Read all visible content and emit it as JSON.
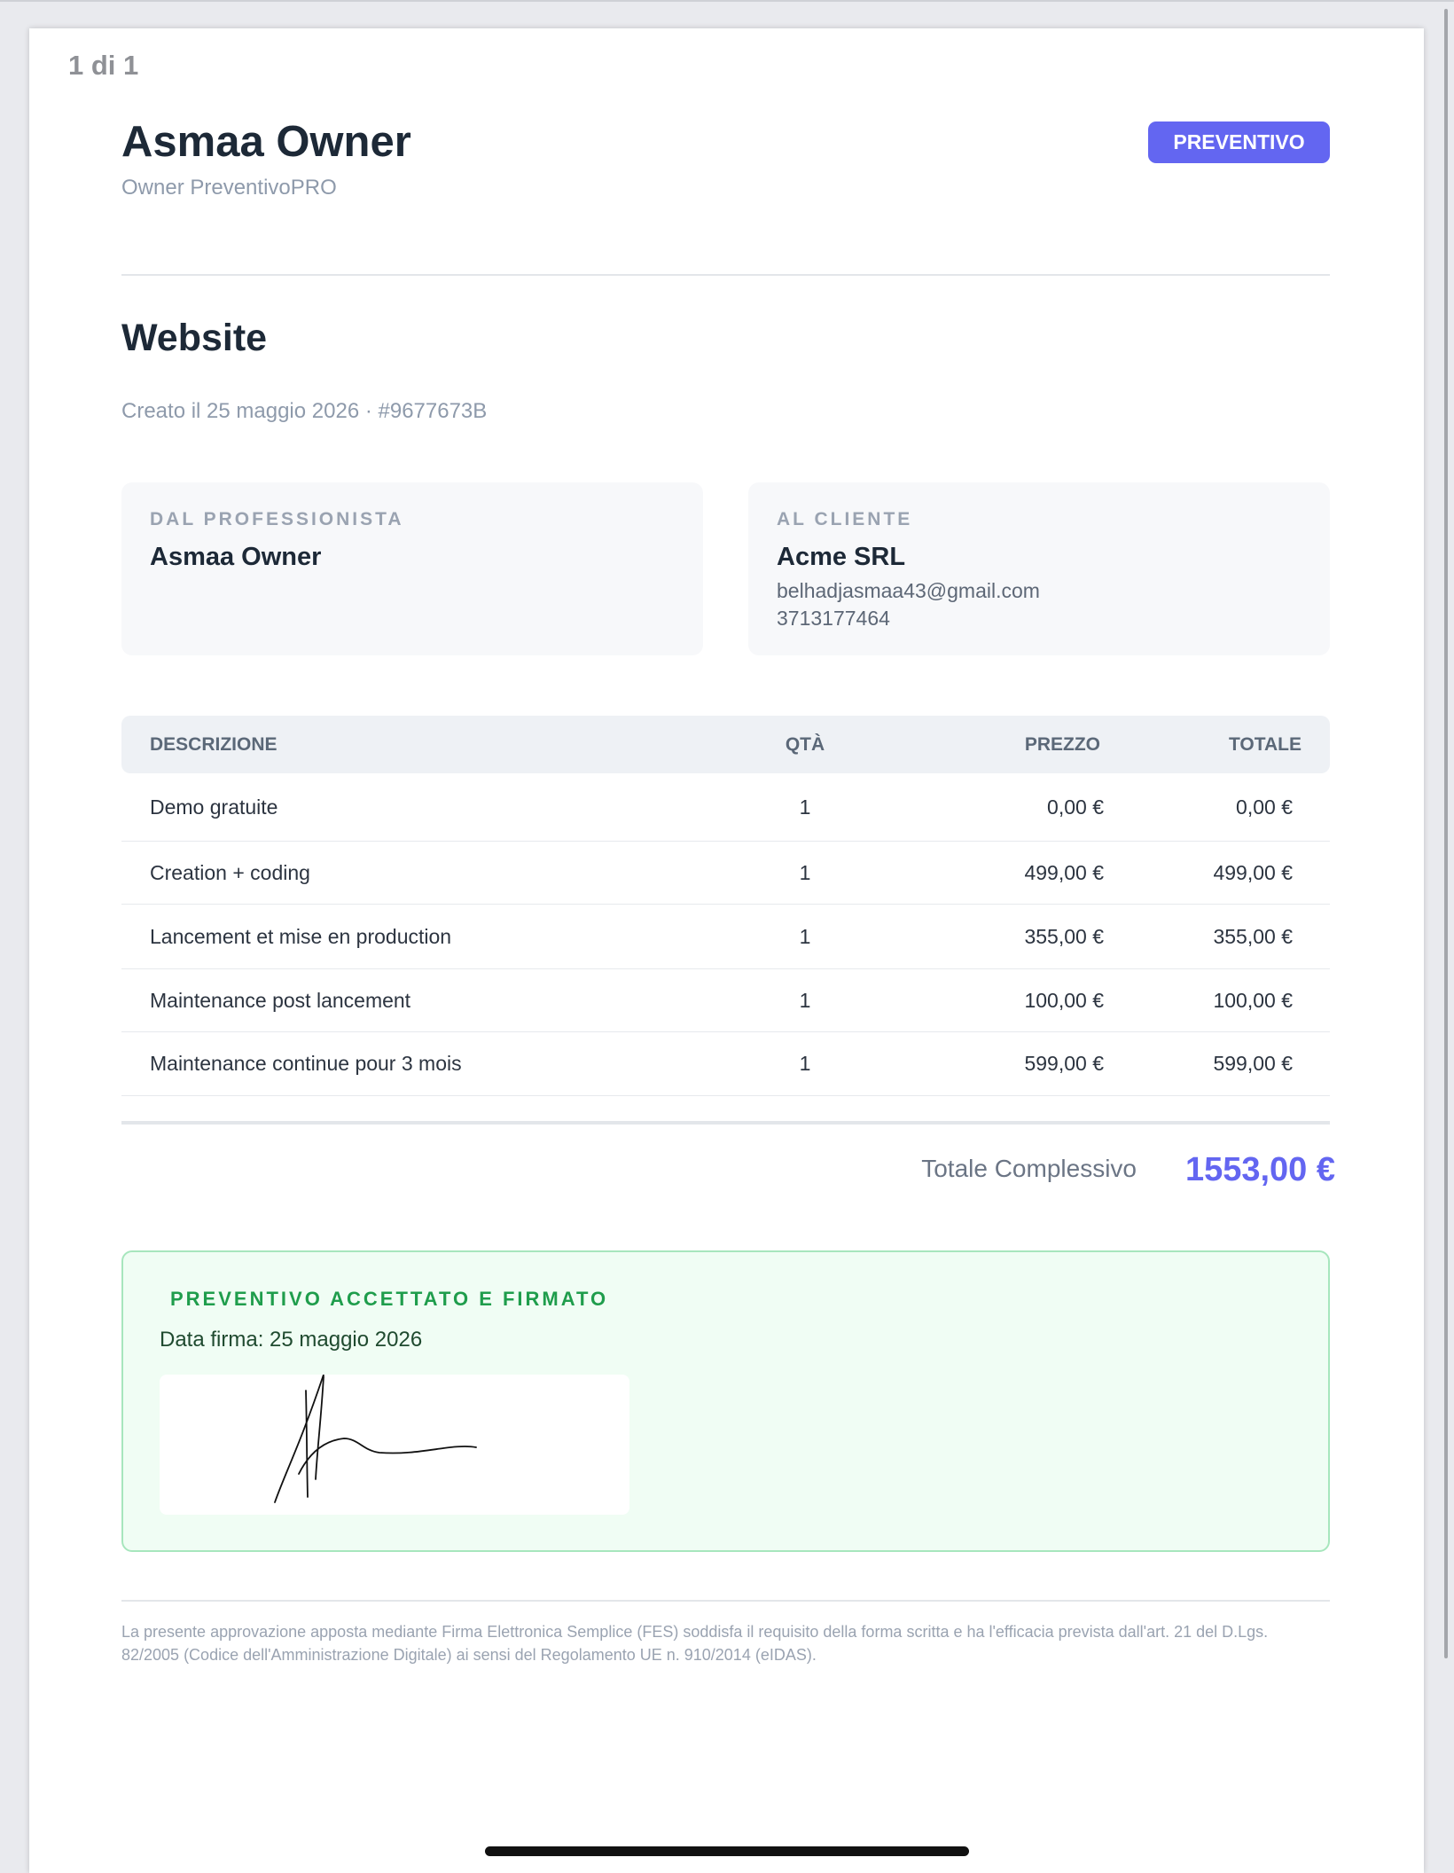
{
  "page_indicator": "1 di 1",
  "header": {
    "name": "Asmaa Owner",
    "subtitle": "Owner PreventivoPRO",
    "badge": "PREVENTIVO"
  },
  "document": {
    "title": "Website",
    "meta": "Creato il 25 maggio 2026 · #9677673B"
  },
  "from": {
    "label": "DAL PROFESSIONISTA",
    "name": "Asmaa Owner"
  },
  "to": {
    "label": "AL CLIENTE",
    "name": "Acme SRL",
    "email": "belhadjasmaa43@gmail.com",
    "phone": "3713177464"
  },
  "table": {
    "headers": {
      "description": "DESCRIZIONE",
      "qty": "QTÀ",
      "price": "PREZZO",
      "total": "TOTALE"
    },
    "rows": [
      {
        "description": "Demo gratuite",
        "qty": "1",
        "price": "0,00 €",
        "total": "0,00 €"
      },
      {
        "description": "Creation + coding",
        "qty": "1",
        "price": "499,00 €",
        "total": "499,00 €"
      },
      {
        "description": "Lancement et mise en production",
        "qty": "1",
        "price": "355,00 €",
        "total": "355,00 €"
      },
      {
        "description": "Maintenance post lancement",
        "qty": "1",
        "price": "100,00 €",
        "total": "100,00 €"
      },
      {
        "description": "Maintenance continue pour 3 mois",
        "qty": "1",
        "price": "599,00 €",
        "total": "599,00 €"
      }
    ]
  },
  "totals": {
    "label": "Totale Complessivo",
    "value": "1553,00 €"
  },
  "signature": {
    "title": "PREVENTIVO ACCETTATO E FIRMATO",
    "date": "Data firma: 25 maggio 2026"
  },
  "footer": {
    "note": "La presente approvazione apposta mediante Firma Elettronica Semplice (FES) soddisfa il requisito della forma scritta e ha l'efficacia prevista dall'art. 21 del D.Lgs. 82/2005 (Codice dell'Amministrazione Digitale) ai sensi del Regolamento UE n. 910/2014 (eIDAS)."
  },
  "colors": {
    "accent": "#6366f1",
    "success": "#1f9d4c",
    "heading": "#1d2937",
    "muted": "#8e9aab"
  }
}
